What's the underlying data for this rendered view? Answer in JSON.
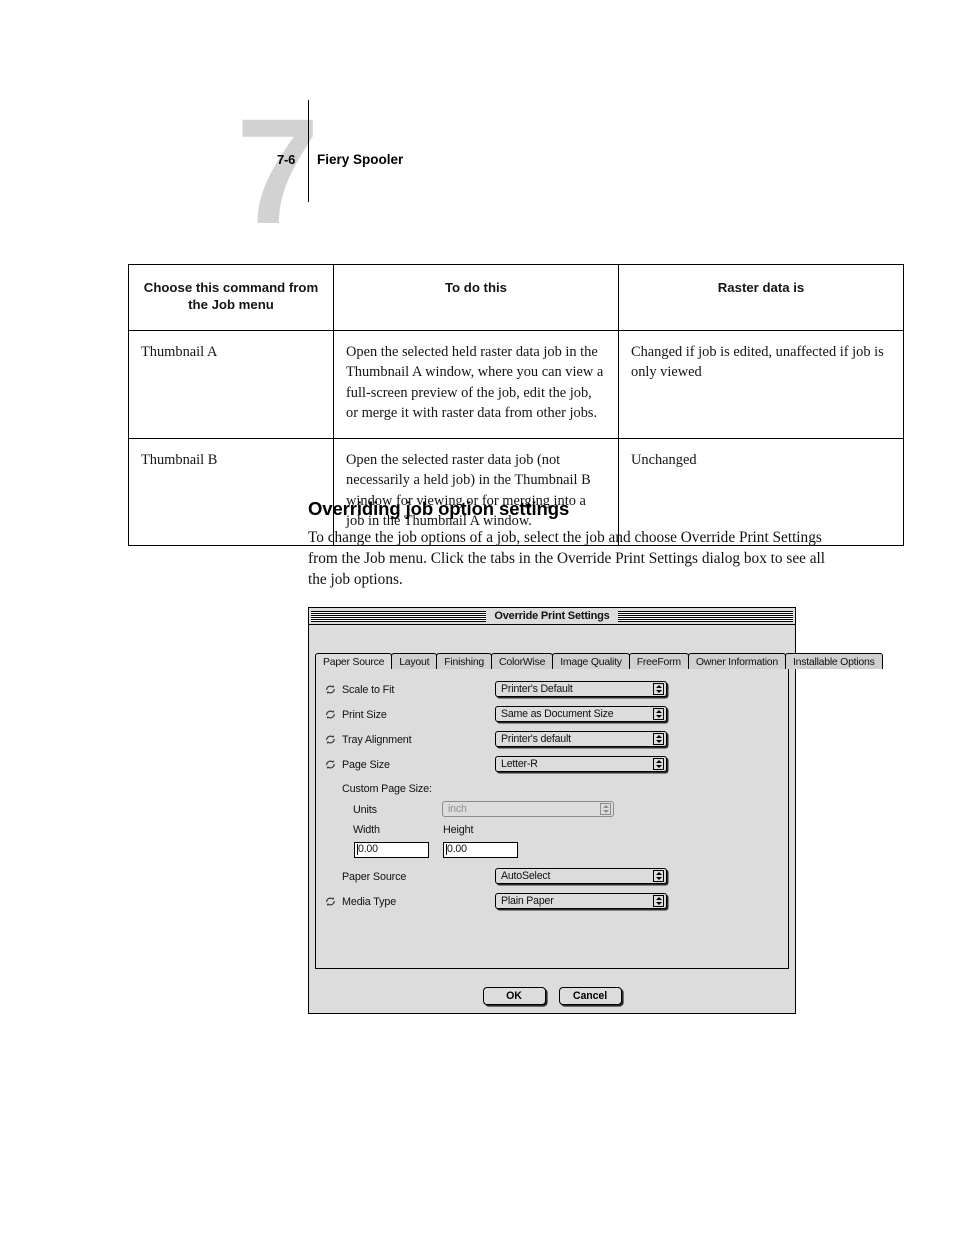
{
  "page": {
    "chapter_number": "7",
    "folio": "7-6",
    "running_head": "Fiery Spooler"
  },
  "table": {
    "headers": [
      "Choose this command from the Job menu",
      "To do this",
      "Raster data is"
    ],
    "header_lines": {
      "col1_line1": "Choose this command",
      "col1_line2": "from the Job menu",
      "col2": "To do this",
      "col3": "Raster data is"
    },
    "rows": [
      {
        "command": "Thumbnail A",
        "todo_lines": [
          "Open the selected held raster data job in the",
          "Thumbnail A window, where you can view a",
          "full-screen preview of the job, edit the job,",
          "or merge it with raster data from other jobs."
        ],
        "raster_lines": [
          "Changed if job is edited, unaffected if job is",
          "only viewed"
        ]
      },
      {
        "command": "Thumbnail B",
        "todo_lines": [
          "Open the selected raster data job (not",
          "necessarily a held job) in the Thumbnail B",
          "window for viewing or for merging into a",
          "job in the Thumbnail A window."
        ],
        "raster_lines": [
          "Unchanged"
        ]
      }
    ]
  },
  "section": {
    "heading": "Overriding job option settings",
    "paragraph_lines": [
      "To change the job options of a job, select the job and choose Override Print Settings",
      "from the Job menu. Click the tabs in the Override Print Settings dialog box to see all",
      "the job options."
    ]
  },
  "dialog": {
    "title": "Override Print Settings",
    "tabs": [
      {
        "label": "Paper Source",
        "active": true
      },
      {
        "label": "Layout",
        "active": false
      },
      {
        "label": "Finishing",
        "active": false
      },
      {
        "label": "ColorWise",
        "active": false
      },
      {
        "label": "Image Quality",
        "active": false
      },
      {
        "label": "FreeForm",
        "active": false
      },
      {
        "label": "Owner Information",
        "active": false
      },
      {
        "label": "Installable Options",
        "active": false
      }
    ],
    "options": [
      {
        "label": "Scale to Fit",
        "value": "Printer's Default",
        "icon": "override-loop-icon",
        "has_icon": true
      },
      {
        "label": "Print Size",
        "value": "Same as Document Size",
        "icon": "override-loop-icon",
        "has_icon": true
      },
      {
        "label": "Tray Alignment",
        "value": "Printer's default",
        "icon": "override-loop-icon",
        "has_icon": true
      },
      {
        "label": "Page Size",
        "value": "Letter-R",
        "icon": "override-loop-icon",
        "has_icon": true
      }
    ],
    "custom_page_size": {
      "group_label": "Custom Page Size:",
      "units_label": "Units",
      "units_value": "inch",
      "units_disabled": true,
      "width_label": "Width",
      "width_value": "0.00",
      "height_label": "Height",
      "height_value": "0.00"
    },
    "bottom_options": [
      {
        "label": "Paper Source",
        "value": "AutoSelect",
        "has_icon": false
      },
      {
        "label": "Media Type",
        "value": "Plain Paper",
        "has_icon": true
      }
    ],
    "buttons": {
      "ok": "OK",
      "cancel": "Cancel"
    }
  },
  "colors": {
    "chapter_number": "#d2d2d2",
    "dialog_face": "#dcdcdc",
    "dialog_border": "#000000",
    "field_background": "#ffffff",
    "disabled_text": "#8e8e8e"
  }
}
